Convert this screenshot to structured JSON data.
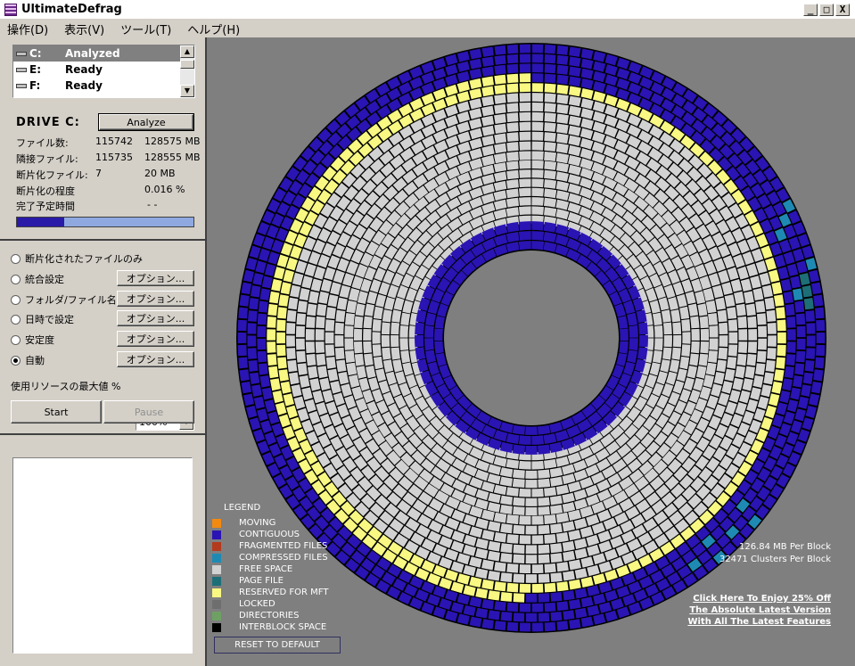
{
  "window": {
    "title": "UltimateDefrag",
    "buttons": {
      "minimize": "_",
      "maximize": "□",
      "close": "X"
    }
  },
  "menu": [
    "操作(D)",
    "表示(V)",
    "ツール(T)",
    "ヘルプ(H)"
  ],
  "drives": [
    {
      "letter": "C:",
      "status": "Analyzed",
      "selected": true
    },
    {
      "letter": "E:",
      "status": "Ready",
      "selected": false
    },
    {
      "letter": "F:",
      "status": "Ready",
      "selected": false
    }
  ],
  "drive_panel": {
    "title": "DRIVE C:",
    "analyze_label": "Analyze",
    "stats": [
      {
        "label": "ファイル数:",
        "value": "115742",
        "size": "128575 MB"
      },
      {
        "label": "隣接ファイル:",
        "value": "115735",
        "size": "128555 MB"
      },
      {
        "label": "断片化ファイル:",
        "value": "7",
        "size": "20 MB"
      },
      {
        "label": "断片化の程度",
        "value": "",
        "size": "0.016 %"
      },
      {
        "label": "完了予定時間",
        "value": "",
        "size": "- -"
      }
    ],
    "progress": 0.27
  },
  "options": [
    {
      "label": "断片化されたファイルのみ",
      "checked": false,
      "button": ""
    },
    {
      "label": "統合設定",
      "checked": false,
      "button": "オプション..."
    },
    {
      "label": "フォルダ/ファイル名",
      "checked": false,
      "button": "オプション..."
    },
    {
      "label": "日時で設定",
      "checked": false,
      "button": "オプション..."
    },
    {
      "label": "安定度",
      "checked": false,
      "button": "オプション..."
    },
    {
      "label": "自動",
      "checked": true,
      "button": "オプション..."
    }
  ],
  "resource": {
    "label": "使用リソースの最大値 %",
    "value": "100%"
  },
  "actions": {
    "start": "Start",
    "pause": "Pause"
  },
  "legend": {
    "title": "LEGEND",
    "items": [
      {
        "label": "MOVING",
        "color": "#f28a10"
      },
      {
        "label": "CONTIGUOUS",
        "color": "#2a14b4"
      },
      {
        "label": "FRAGMENTED FILES",
        "color": "#b43a1e"
      },
      {
        "label": "COMPRESSED FILES",
        "color": "#1e8ab4"
      },
      {
        "label": "FREE SPACE",
        "color": "#d2d2d2"
      },
      {
        "label": "PAGE FILE",
        "color": "#1e6e78"
      },
      {
        "label": "RESERVED FOR MFT",
        "color": "#f8f882"
      },
      {
        "label": "LOCKED",
        "color": "#6e6e6e"
      },
      {
        "label": "DIRECTORIES",
        "color": "#6ea064"
      },
      {
        "label": "INTERBLOCK SPACE",
        "color": "#000000"
      }
    ],
    "reset_label": "RESET TO DEFAULT"
  },
  "block_info": [
    "126.84 MB Per Block",
    "32471 Clusters Per Block"
  ],
  "promo": [
    "Click Here To Enjoy 25% Off",
    "The Absolute Latest Version",
    "With All The Latest Features"
  ],
  "icons": {
    "app": "defrag-app-icon",
    "drive": "hard-drive-icon"
  }
}
